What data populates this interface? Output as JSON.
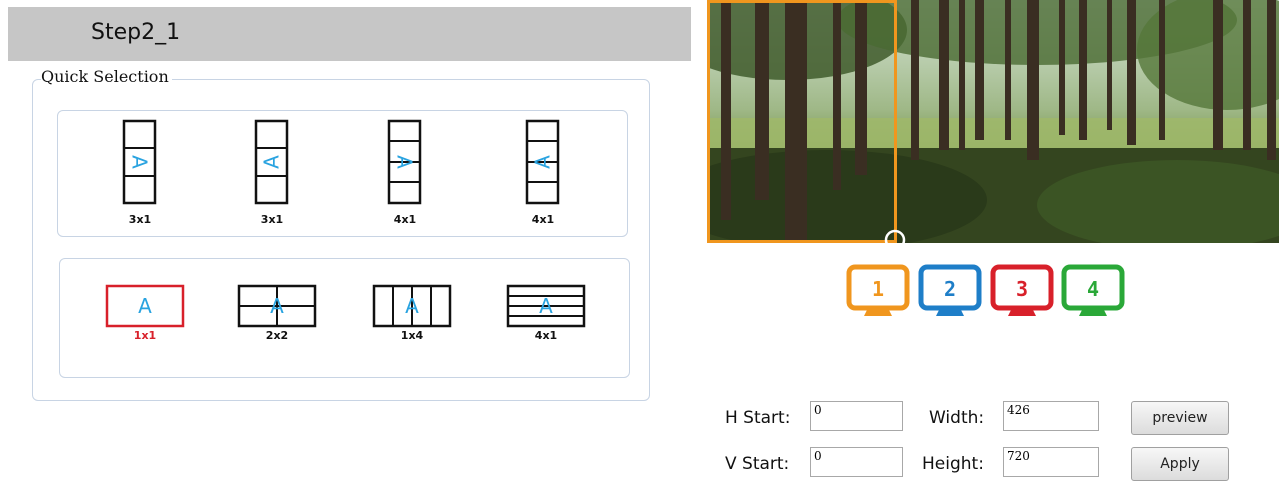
{
  "header": {
    "title": "Step2_1"
  },
  "quick_selection": {
    "legend": "Quick Selection",
    "rotated_presets": [
      {
        "label": "3x1",
        "glyph": "A",
        "rotation": "clockwise",
        "selected": false
      },
      {
        "label": "3x1",
        "glyph": "A",
        "rotation": "counter-clockwise",
        "selected": false
      },
      {
        "label": "4x1",
        "glyph": "A",
        "rotation": "clockwise",
        "selected": false
      },
      {
        "label": "4x1",
        "glyph": "A",
        "rotation": "counter-clockwise",
        "selected": false
      }
    ],
    "landscape_presets": [
      {
        "label": "1x1",
        "glyph": "A",
        "selected": true
      },
      {
        "label": "2x2",
        "glyph": "A",
        "selected": false
      },
      {
        "label": "1x4",
        "glyph": "A",
        "selected": false
      },
      {
        "label": "4x1",
        "glyph": "A",
        "selected": false
      }
    ]
  },
  "monitors": [
    {
      "number": "1",
      "color": "#f0961e"
    },
    {
      "number": "2",
      "color": "#1e7ec8"
    },
    {
      "number": "3",
      "color": "#d8202a"
    },
    {
      "number": "4",
      "color": "#2aa838"
    }
  ],
  "form": {
    "h_start_label": "H Start:",
    "h_start_value": "0",
    "v_start_label": "V Start:",
    "v_start_value": "0",
    "width_label": "Width:",
    "width_value": "426",
    "height_label": "Height:",
    "height_value": "720",
    "preview_label": "preview",
    "apply_label": "Apply"
  },
  "colors": {
    "accent_blue": "#29a3e0",
    "selected_red": "#d8202a",
    "crop_orange": "#f0961e"
  }
}
